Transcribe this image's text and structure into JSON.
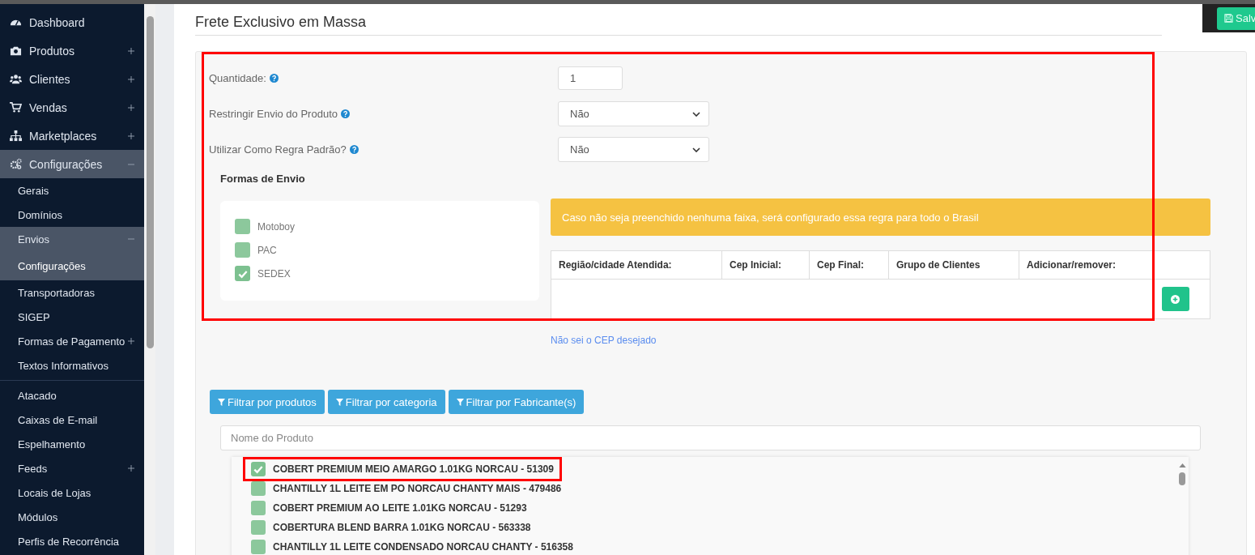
{
  "sidebar": {
    "items": [
      {
        "label": "Dashboard",
        "selected": false
      },
      {
        "label": "Produtos",
        "selected": false,
        "expanded": false
      },
      {
        "label": "Clientes",
        "selected": false,
        "expanded": false
      },
      {
        "label": "Vendas",
        "selected": false,
        "expanded": false
      },
      {
        "label": "Marketplaces",
        "selected": false,
        "expanded": false
      },
      {
        "label": "Configurações",
        "selected": true,
        "expanded": true,
        "children": [
          {
            "label": "Gerais",
            "selected": false
          },
          {
            "label": "Domínios",
            "selected": false
          },
          {
            "label": "Envios",
            "selected": false,
            "expanded": true,
            "children": [
              {
                "label": "Configurações",
                "selected": true
              }
            ]
          },
          {
            "label": "Transportadoras",
            "selected": false
          },
          {
            "label": "SIGEP",
            "selected": false
          },
          {
            "label": "Formas de Pagamento",
            "selected": false,
            "expanded": false
          },
          {
            "label": "Textos Informativos",
            "selected": false
          },
          {
            "label": "Atacado",
            "selected": false,
            "divider_before": true
          },
          {
            "label": "Caixas de E-mail",
            "selected": false
          },
          {
            "label": "Espelhamento",
            "selected": false
          },
          {
            "label": "Feeds",
            "selected": false,
            "expanded": false
          },
          {
            "label": "Locais de Lojas",
            "selected": false
          },
          {
            "label": "Módulos",
            "selected": false
          },
          {
            "label": "Perfis de Recorrência",
            "selected": false
          }
        ]
      }
    ]
  },
  "header": {
    "title": "Frete Exclusivo em Massa",
    "save_button": "Salv"
  },
  "form": {
    "highlighted": true,
    "fields": [
      {
        "label": "Quantidade:",
        "kind": "text",
        "value": "1"
      },
      {
        "label": "Restringir Envio do Produto",
        "kind": "select",
        "value": "Não"
      },
      {
        "label": "Utilizar Como Regra Padrão?",
        "kind": "select",
        "value": "Não"
      }
    ],
    "shipping_methods": {
      "title": "Formas de Envio",
      "options": [
        {
          "label": "Motoboy",
          "checked": false
        },
        {
          "label": "PAC",
          "checked": false
        },
        {
          "label": "SEDEX",
          "checked": true
        }
      ]
    },
    "alert": "Caso não seja preenchido nenhuma faixa, será configurado essa regra para todo o Brasil",
    "ranges_table": {
      "columns": [
        "Região/cidade Atendida:",
        "Cep Inicial:",
        "Cep Final:",
        "Grupo de Clientes",
        "Adicionar/remover:"
      ]
    },
    "cep_link": "Não sei o CEP desejado"
  },
  "filters": {
    "buttons": [
      "Filtrar por produtos",
      "Filtrar por categoria",
      "Filtrar por Fabricante(s)"
    ]
  },
  "product_search": {
    "placeholder": "Nome do Produto"
  },
  "products": [
    {
      "name": "COBERT PREMIUM MEIO AMARGO 1.01KG NORCAU - 51309",
      "checked": true,
      "highlighted": true
    },
    {
      "name": "CHANTILLY 1L LEITE EM PO NORCAU CHANTY MAIS - 479486",
      "checked": false,
      "highlighted": false
    },
    {
      "name": "COBERT PREMIUM AO LEITE 1.01KG NORCAU - 51293",
      "checked": false,
      "highlighted": false
    },
    {
      "name": "COBERTURA BLEND BARRA 1.01KG NORCAU - 563338",
      "checked": false,
      "highlighted": false
    },
    {
      "name": "CHANTILLY 1L LEITE CONDENSADO NORCAU CHANTY - 516358",
      "checked": false,
      "highlighted": false
    }
  ]
}
